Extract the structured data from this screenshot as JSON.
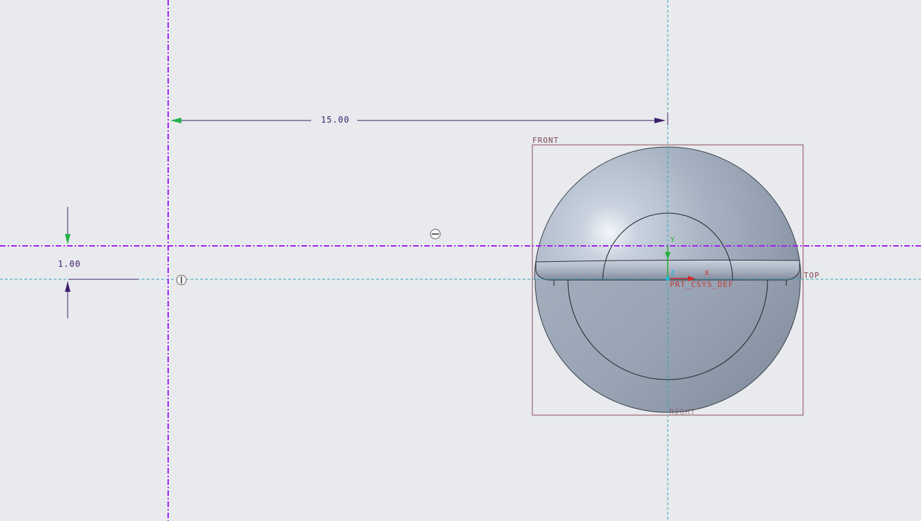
{
  "app": {
    "view": "sketch-3d-viewport"
  },
  "dimensions": {
    "horizontal": "15.00",
    "vertical": "1.00"
  },
  "datum_planes": {
    "front": "FRONT",
    "top": "TOP",
    "right": "RIGHT"
  },
  "csys": {
    "name": "PRT_CSYS_DEF",
    "axis_z": "Z",
    "axis_x": "X",
    "axis_y": "Y"
  },
  "constraints": {
    "horizontal_symbol": "—",
    "vertical_symbol": "|"
  },
  "colors": {
    "background": "#e8eaed",
    "centerline": "#a020f0",
    "reference_axis": "#2aa6b4",
    "dimension": "#3c1f6b",
    "datum_plane": "#7d4654",
    "model_fill": "#a4b0c0"
  }
}
